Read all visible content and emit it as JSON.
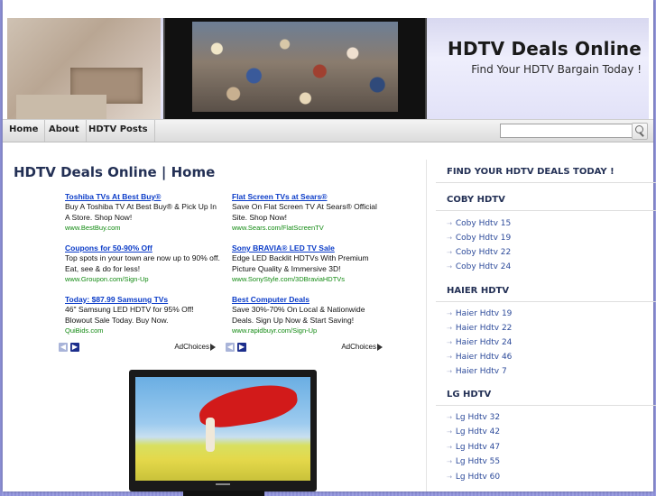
{
  "header": {
    "site_title": "HDTV Deals Online",
    "tagline": "Find Your HDTV Bargain Today !"
  },
  "nav": {
    "items": [
      "Home",
      "About",
      "HDTV Posts"
    ],
    "search_placeholder": ""
  },
  "main": {
    "page_title": "HDTV Deals Online | Home",
    "ads_left": [
      {
        "title": "Toshiba TVs At Best Buy®",
        "desc": "Buy A Toshiba TV At Best Buy® & Pick Up In A Store. Shop Now!",
        "url": "www.BestBuy.com"
      },
      {
        "title": "Coupons for 50-90% Off",
        "desc": "Top spots in your town are now up to 90% off. Eat, see & do for less!",
        "url": "www.Groupon.com/Sign-Up"
      },
      {
        "title": "Today: $87.99 Samsung TVs",
        "desc": "46\" Samsung LED HDTV for 95% Off! Blowout Sale Today. Buy Now.",
        "url": "QuiBids.com"
      }
    ],
    "ads_right": [
      {
        "title": "Flat Screen TVs at Sears®",
        "desc": "Save On Flat Screen TV At Sears® Official Site. Shop Now!",
        "url": "www.Sears.com/FlatScreenTV"
      },
      {
        "title": "Sony BRAVIA® LED TV Sale",
        "desc": "Edge LED Backlit HDTVs With Premium Picture Quality & Immersive 3D!",
        "url": "www.SonyStyle.com/3DBraviaHDTVs"
      },
      {
        "title": "Best Computer Deals",
        "desc": "Save 30%-70% On Local & Nationwide Deals. Sign Up Now & Start Saving!",
        "url": "www.rapidbuyr.com/Sign-Up"
      }
    ],
    "adchoices_label": "AdChoices",
    "prev_arrow": "◀",
    "next_arrow": "▶"
  },
  "sidebar": {
    "find_heading": "FIND YOUR HDTV DEALS TODAY !",
    "sections": [
      {
        "heading": "COBY HDTV",
        "links": [
          "Coby Hdtv 15",
          "Coby Hdtv 19",
          "Coby Hdtv 22",
          "Coby Hdtv 24"
        ]
      },
      {
        "heading": "HAIER HDTV",
        "links": [
          "Haier Hdtv 19",
          "Haier Hdtv 22",
          "Haier Hdtv 24",
          "Haier Hdtv 46",
          "Haier Hdtv 7"
        ]
      },
      {
        "heading": "LG HDTV",
        "links": [
          "Lg Hdtv 32",
          "Lg Hdtv 42",
          "Lg Hdtv 47",
          "Lg Hdtv 55",
          "Lg Hdtv 60"
        ]
      }
    ],
    "bullet": "⇢"
  },
  "colors": {
    "background": "#9a9de0",
    "heading": "#233055",
    "link": "#2c4a9a",
    "ad_title": "#0a3bc8",
    "ad_url": "#128a12"
  }
}
